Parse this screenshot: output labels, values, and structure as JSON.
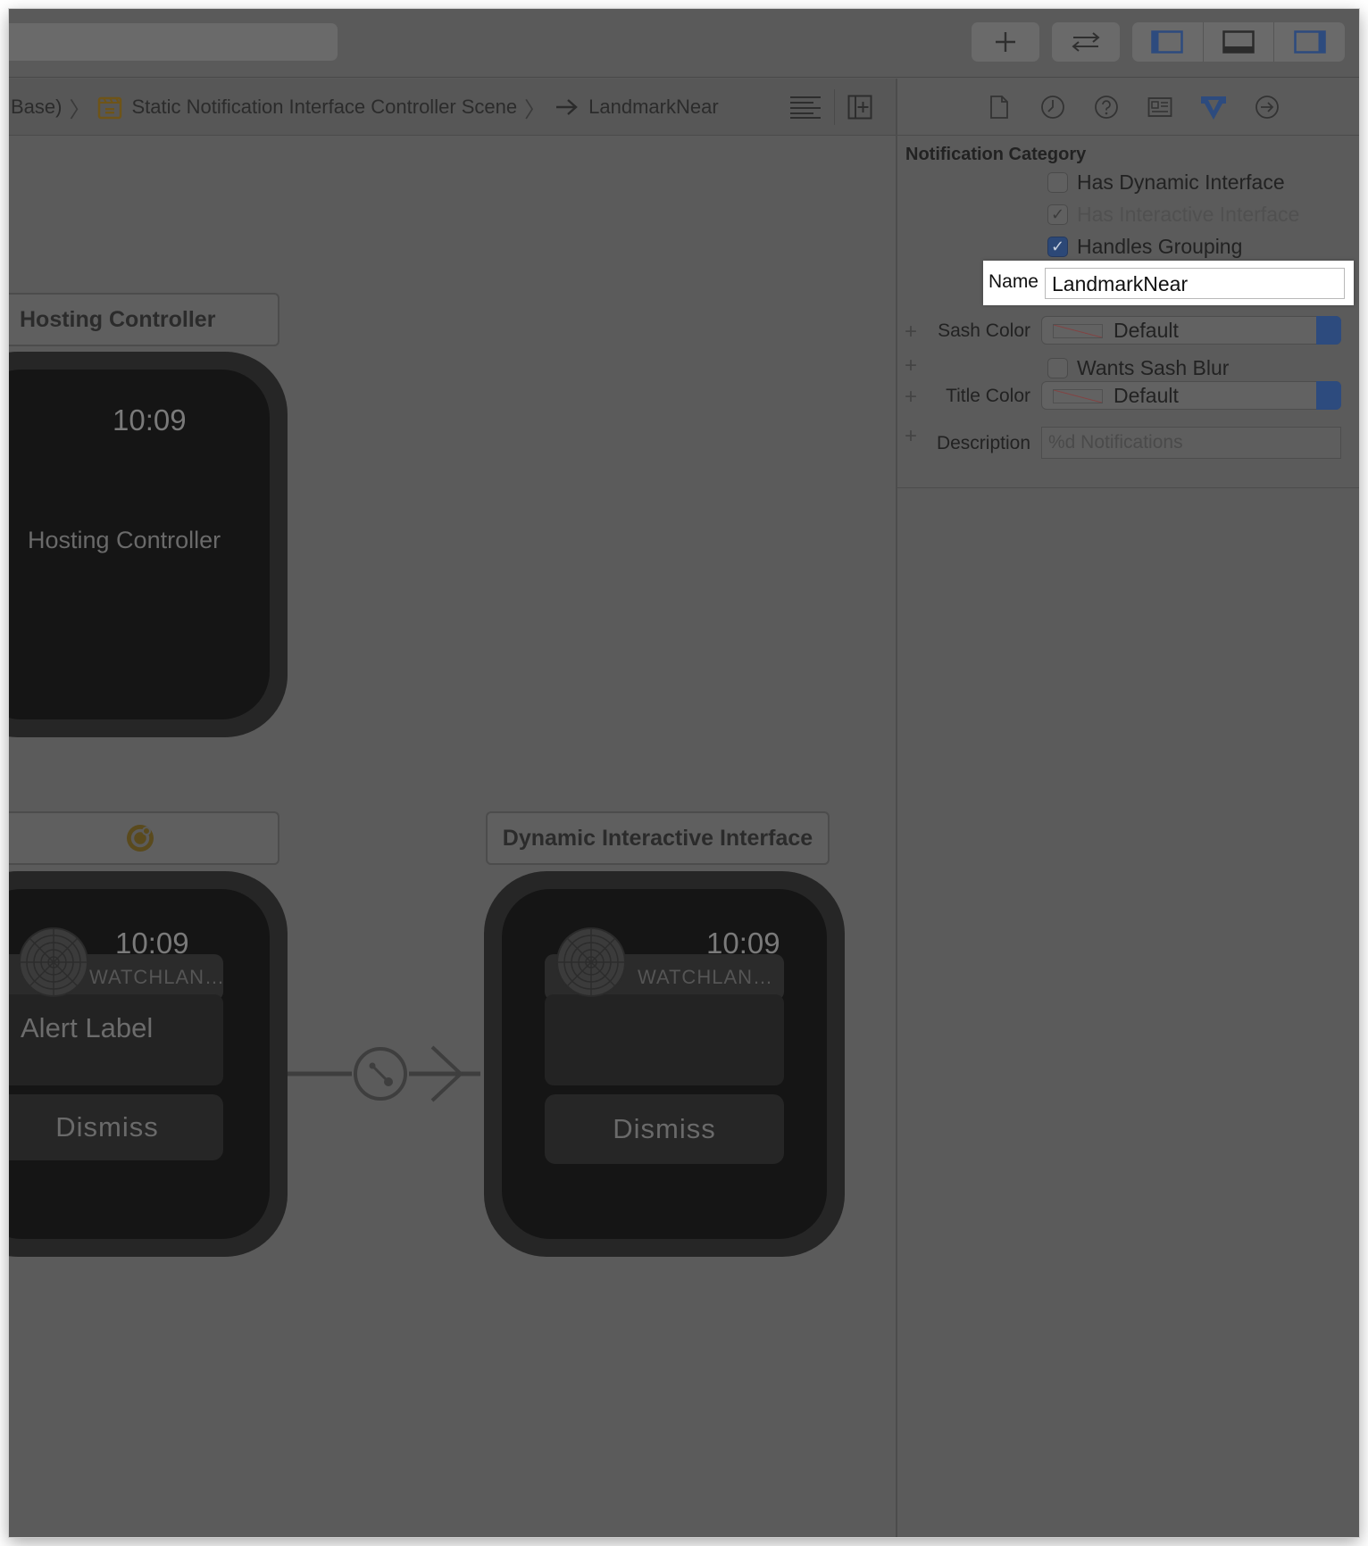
{
  "breadcrumb": {
    "base": "Base)",
    "scene": "Static Notification Interface Controller Scene",
    "target": "LandmarkNear"
  },
  "canvas": {
    "hosting_controller_title": "Hosting Controller",
    "hosting_time": "10:09",
    "hosting_label": "Hosting Controller",
    "static_time": "10:09",
    "static_app_name": "WATCHLAN…",
    "static_alert_label": "Alert Label",
    "static_dismiss": "Dismiss",
    "dynamic_title": "Dynamic Interactive Interface",
    "dynamic_time": "10:09",
    "dynamic_app_name": "WATCHLAN…",
    "dynamic_dismiss": "Dismiss"
  },
  "inspector": {
    "section_title": "Notification Category",
    "has_dynamic_interface": {
      "label": "Has Dynamic Interface",
      "checked": false
    },
    "has_interactive_interface": {
      "label": "Has Interactive Interface",
      "checked": true,
      "disabled": true
    },
    "handles_grouping": {
      "label": "Handles Grouping",
      "checked": true
    },
    "name_label": "Name",
    "name_value": "LandmarkNear",
    "sash_color_label": "Sash Color",
    "sash_color_value": "Default",
    "wants_sash_blur": {
      "label": "Wants Sash Blur",
      "checked": false
    },
    "title_color_label": "Title Color",
    "title_color_value": "Default",
    "description_label": "Description",
    "description_placeholder": "%d Notifications",
    "plus_glyph": "+"
  },
  "colors": {
    "overlay": "#5b5b5b",
    "accent": "#2d4b7e",
    "highlight": "#ffffff",
    "scene_icon": "#c2921e"
  }
}
